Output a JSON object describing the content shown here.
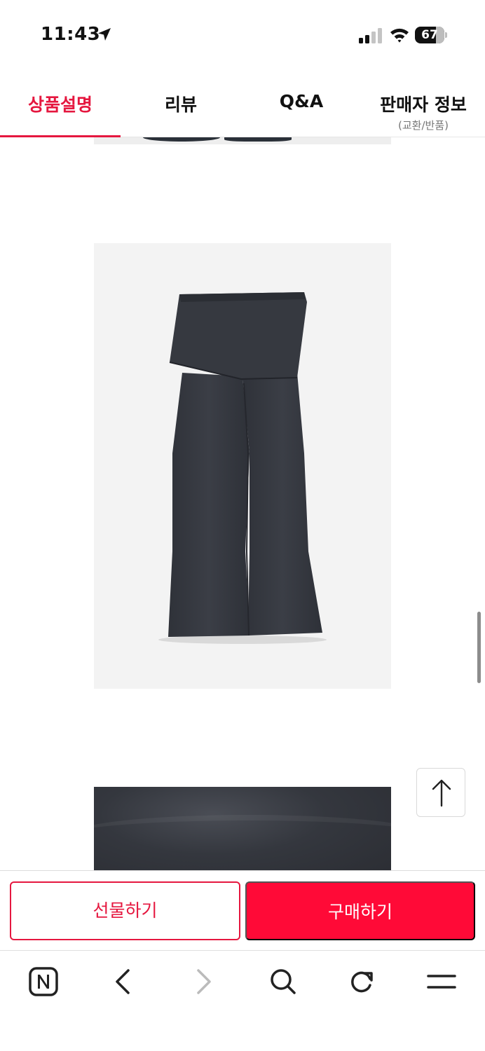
{
  "status_bar": {
    "time": "11:43",
    "battery": "67",
    "icons": [
      "location-arrow-icon",
      "cellular-signal-icon",
      "wifi-icon",
      "battery-icon"
    ]
  },
  "tabs": [
    {
      "label": "상품설명",
      "active": true
    },
    {
      "label": "리뷰",
      "active": false
    },
    {
      "label": "Q&A",
      "active": false
    },
    {
      "label": "판매자 정보",
      "sub": "(교환/반품)",
      "active": false
    }
  ],
  "colors": {
    "accent": "#e5173f",
    "buy_button": "#ff0a37",
    "product_dark": "#33363e"
  },
  "actions": {
    "gift_label": "선물하기",
    "buy_label": "구매하기"
  },
  "browser_nav": {
    "icons": [
      "naver-home-icon",
      "back-arrow-icon",
      "forward-arrow-icon",
      "search-icon",
      "reload-icon",
      "menu-icon"
    ]
  },
  "scroll_top_icon": "arrow-up-icon"
}
